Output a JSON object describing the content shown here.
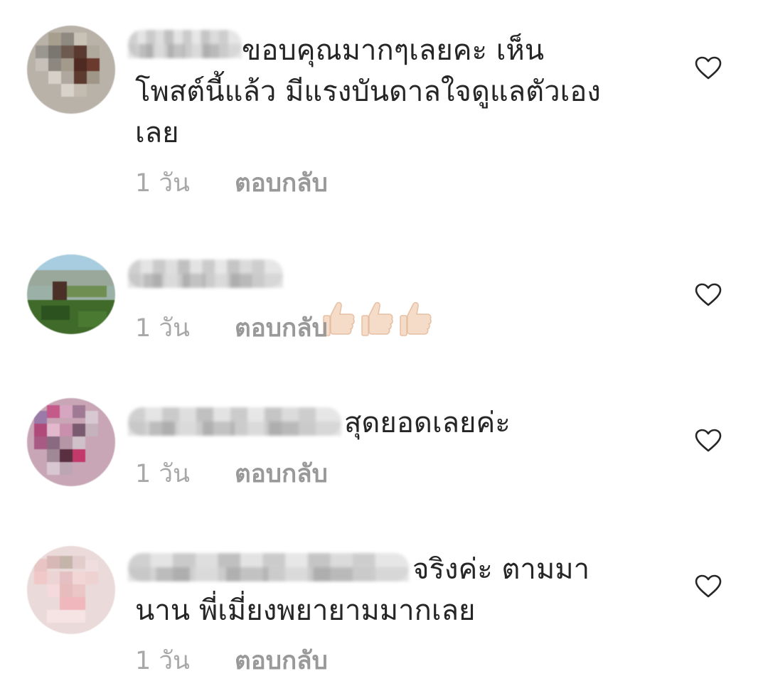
{
  "comments": [
    {
      "text": "ขอบคุณมากๆเลยคะ เห็น\nโพสต์นี้แล้ว มีแรงบันดาลใจดูแลตัวเอง\nเลย",
      "time": "1 วัน",
      "reply": "ตอบกลับ",
      "like_icon": "heart-outline-icon"
    },
    {
      "text": "",
      "emoji": [
        "👍🏻",
        "👍🏻",
        "👍🏻"
      ],
      "time": "1 วัน",
      "reply": "ตอบกลับ",
      "like_icon": "heart-outline-icon"
    },
    {
      "text": "สุดยอดเลยค่ะ",
      "time": "1 วัน",
      "reply": "ตอบกลับ",
      "like_icon": "heart-outline-icon"
    },
    {
      "text": "จริงค่ะ ตามมา\nนาน พี่เมี่ยงพยายามมากเลย",
      "time": "1 วัน",
      "reply": "ตอบกลับ",
      "like_icon": "heart-outline-icon"
    }
  ],
  "colors": {
    "text": "#262626",
    "meta": "#a8a8a8",
    "reply": "#999999",
    "heart_stroke": "#262626"
  }
}
